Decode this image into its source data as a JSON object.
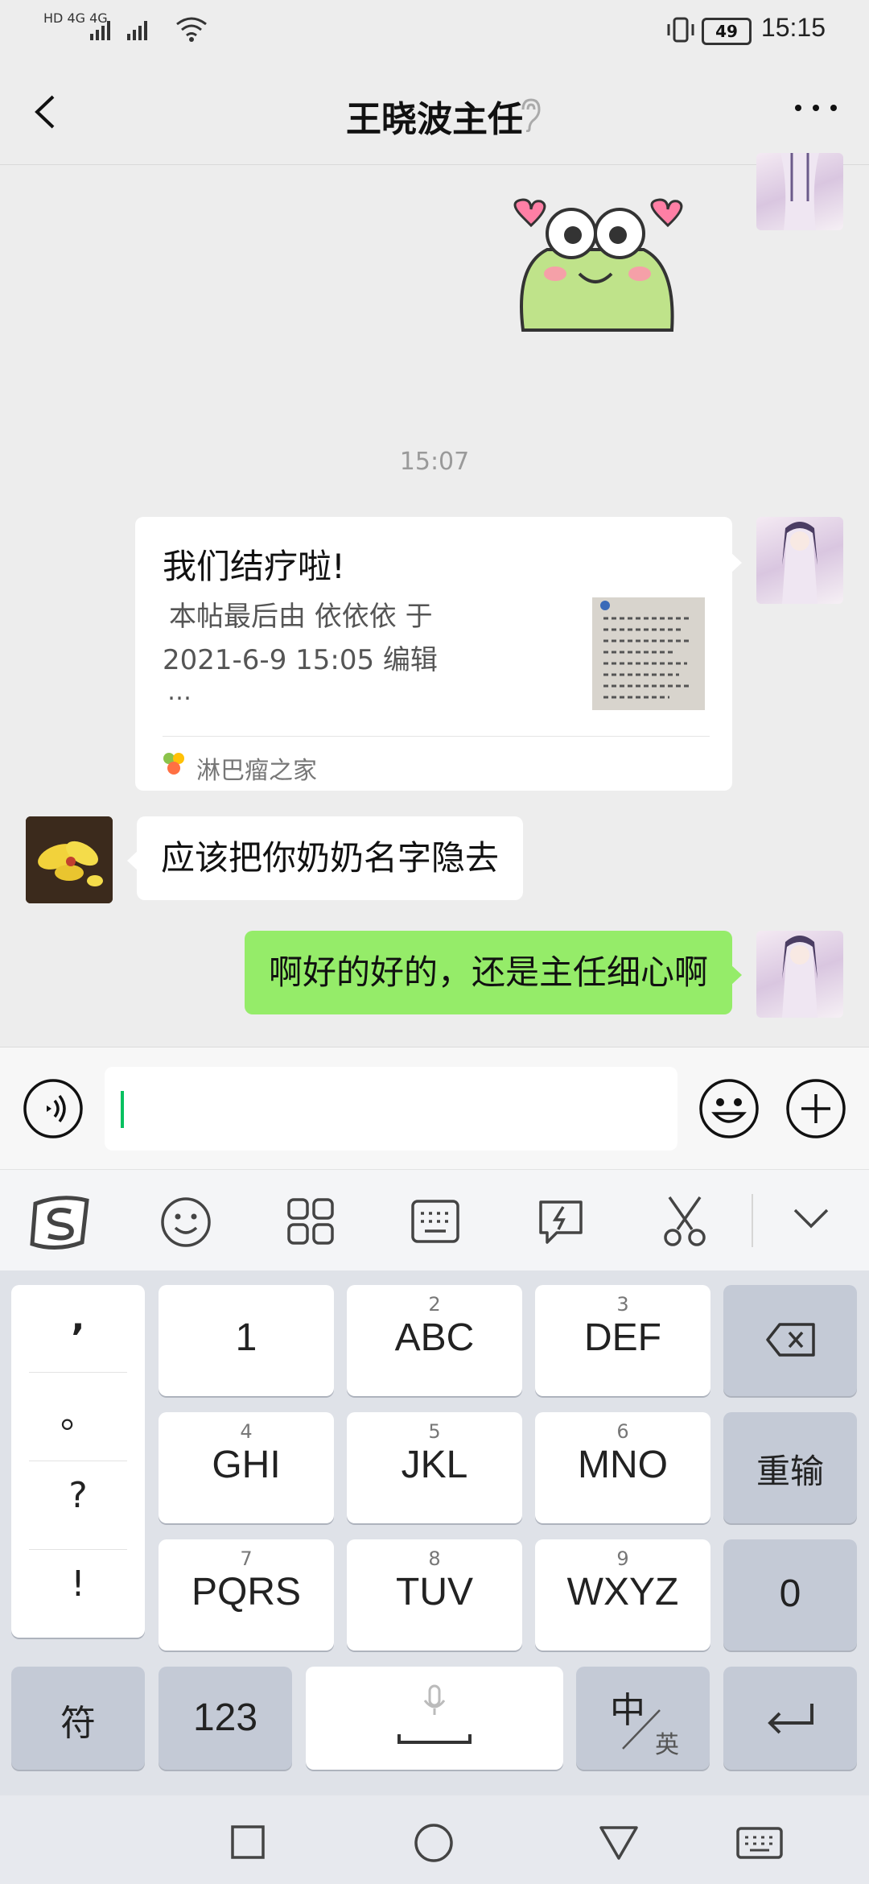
{
  "status_bar": {
    "left_indicators": "HD 4G 4G",
    "battery": "49",
    "time": "15:15"
  },
  "header": {
    "title": "王晓波主任"
  },
  "chat": {
    "timestamp": "15:07",
    "link_card": {
      "title": "我们结疗啦!",
      "desc_line1": "本帖最后由 依依依 于",
      "desc_line2": "2021-6-9 15:05 编辑",
      "desc_more": "…",
      "source": "淋巴瘤之家"
    },
    "incoming_message": "应该把你奶奶名字隐去",
    "outgoing_message": "啊好的好的，还是主任细心啊"
  },
  "keyboard": {
    "punct": [
      ",",
      "。",
      "?",
      "!"
    ],
    "rows": [
      [
        {
          "num": "",
          "label": "1"
        },
        {
          "num": "2",
          "label": "ABC"
        },
        {
          "num": "3",
          "label": "DEF"
        }
      ],
      [
        {
          "num": "4",
          "label": "GHI"
        },
        {
          "num": "5",
          "label": "JKL"
        },
        {
          "num": "6",
          "label": "MNO"
        }
      ],
      [
        {
          "num": "7",
          "label": "PQRS"
        },
        {
          "num": "8",
          "label": "TUV"
        },
        {
          "num": "9",
          "label": "WXYZ"
        }
      ]
    ],
    "reenter": "重输",
    "zero": "0",
    "symbols": "符",
    "numbers": "123",
    "lang_main": "中",
    "lang_sub": "英"
  },
  "colors": {
    "accent_green": "#07c160",
    "bubble_green": "#95ec69"
  }
}
